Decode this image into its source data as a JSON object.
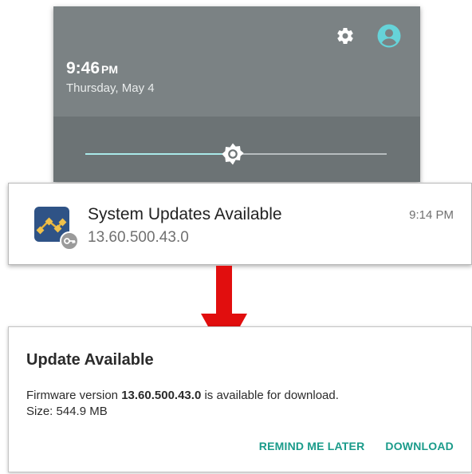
{
  "shade": {
    "time": "9:46",
    "ampm": "PM",
    "date": "Thursday, May 4",
    "brightness_level": 0.49,
    "icons": [
      "gear-icon",
      "account-icon"
    ]
  },
  "notification": {
    "title": "System Updates Available",
    "subtitle": "13.60.500.43.0",
    "time": "9:14 PM"
  },
  "dialog": {
    "title": "Update Available",
    "line1_prefix": "Firmware version ",
    "line1_version": "13.60.500.43.0",
    "line1_suffix": " is available for download.",
    "line2": "Size: 544.9 MB",
    "remind_label": "REMIND ME LATER",
    "download_label": "DOWNLOAD"
  },
  "colors": {
    "accent": "#1a9b8a",
    "arrow": "#e10e0e",
    "shade": "#7b8284"
  }
}
